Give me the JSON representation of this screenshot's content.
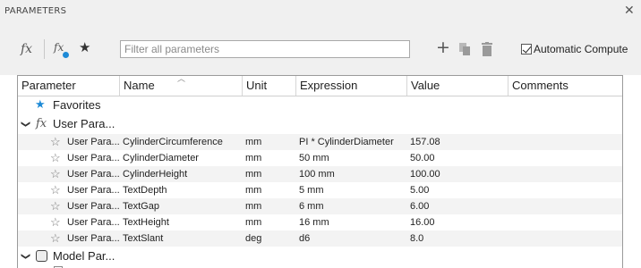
{
  "window": {
    "title": "PARAMETERS",
    "close_glyph": "✕"
  },
  "toolbar": {
    "fx_icon": "fx",
    "fx_user_icon": "fx",
    "favorite_icon": "★",
    "filter_placeholder": "Filter all parameters",
    "add_icon": "+",
    "automatic_compute_label": "Automatic Compute",
    "automatic_compute_checked": true
  },
  "table": {
    "columns": [
      "Parameter",
      "Name",
      "Unit",
      "Expression",
      "Value",
      "Comments"
    ],
    "groups": {
      "favorites": "Favorites",
      "user": "User Para...",
      "model": "Model Par..."
    },
    "rows": [
      {
        "parameter": "User Para...",
        "name": "CylinderCircumference",
        "unit": "mm",
        "expression": "PI * CylinderDiameter",
        "value": "157.08",
        "comments": ""
      },
      {
        "parameter": "User Para...",
        "name": "CylinderDiameter",
        "unit": "mm",
        "expression": "50 mm",
        "value": "50.00",
        "comments": ""
      },
      {
        "parameter": "User Para...",
        "name": "CylinderHeight",
        "unit": "mm",
        "expression": "100 mm",
        "value": "100.00",
        "comments": ""
      },
      {
        "parameter": "User Para...",
        "name": "TextDepth",
        "unit": "mm",
        "expression": "5 mm",
        "value": "5.00",
        "comments": ""
      },
      {
        "parameter": "User Para...",
        "name": "TextGap",
        "unit": "mm",
        "expression": "6 mm",
        "value": "6.00",
        "comments": ""
      },
      {
        "parameter": "User Para...",
        "name": "TextHeight",
        "unit": "mm",
        "expression": "16 mm",
        "value": "16.00",
        "comments": ""
      },
      {
        "parameter": "User Para...",
        "name": "TextSlant",
        "unit": "deg",
        "expression": "d6",
        "value": "8.0",
        "comments": ""
      }
    ]
  },
  "colors": {
    "toolbar_bg": "#f0f0f0",
    "favorites_star": "#1e8ad6",
    "row_alt": "#f3f3f3"
  }
}
